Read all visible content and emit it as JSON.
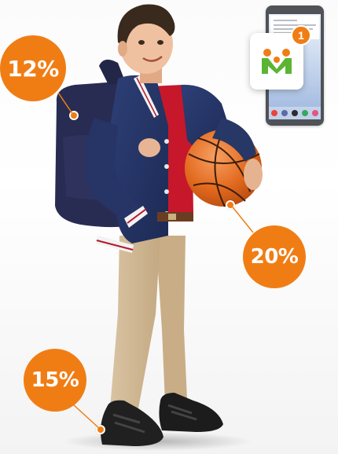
{
  "badges": {
    "backpack": "12%",
    "basketball": "20%",
    "shoes": "15%"
  },
  "notification": {
    "count": "1"
  },
  "colors": {
    "accent": "#f07d14",
    "app_green": "#5bb532",
    "app_orange": "#f07d14"
  },
  "icons": {
    "app": "family-app-icon",
    "phone": "smartphone-icon"
  }
}
